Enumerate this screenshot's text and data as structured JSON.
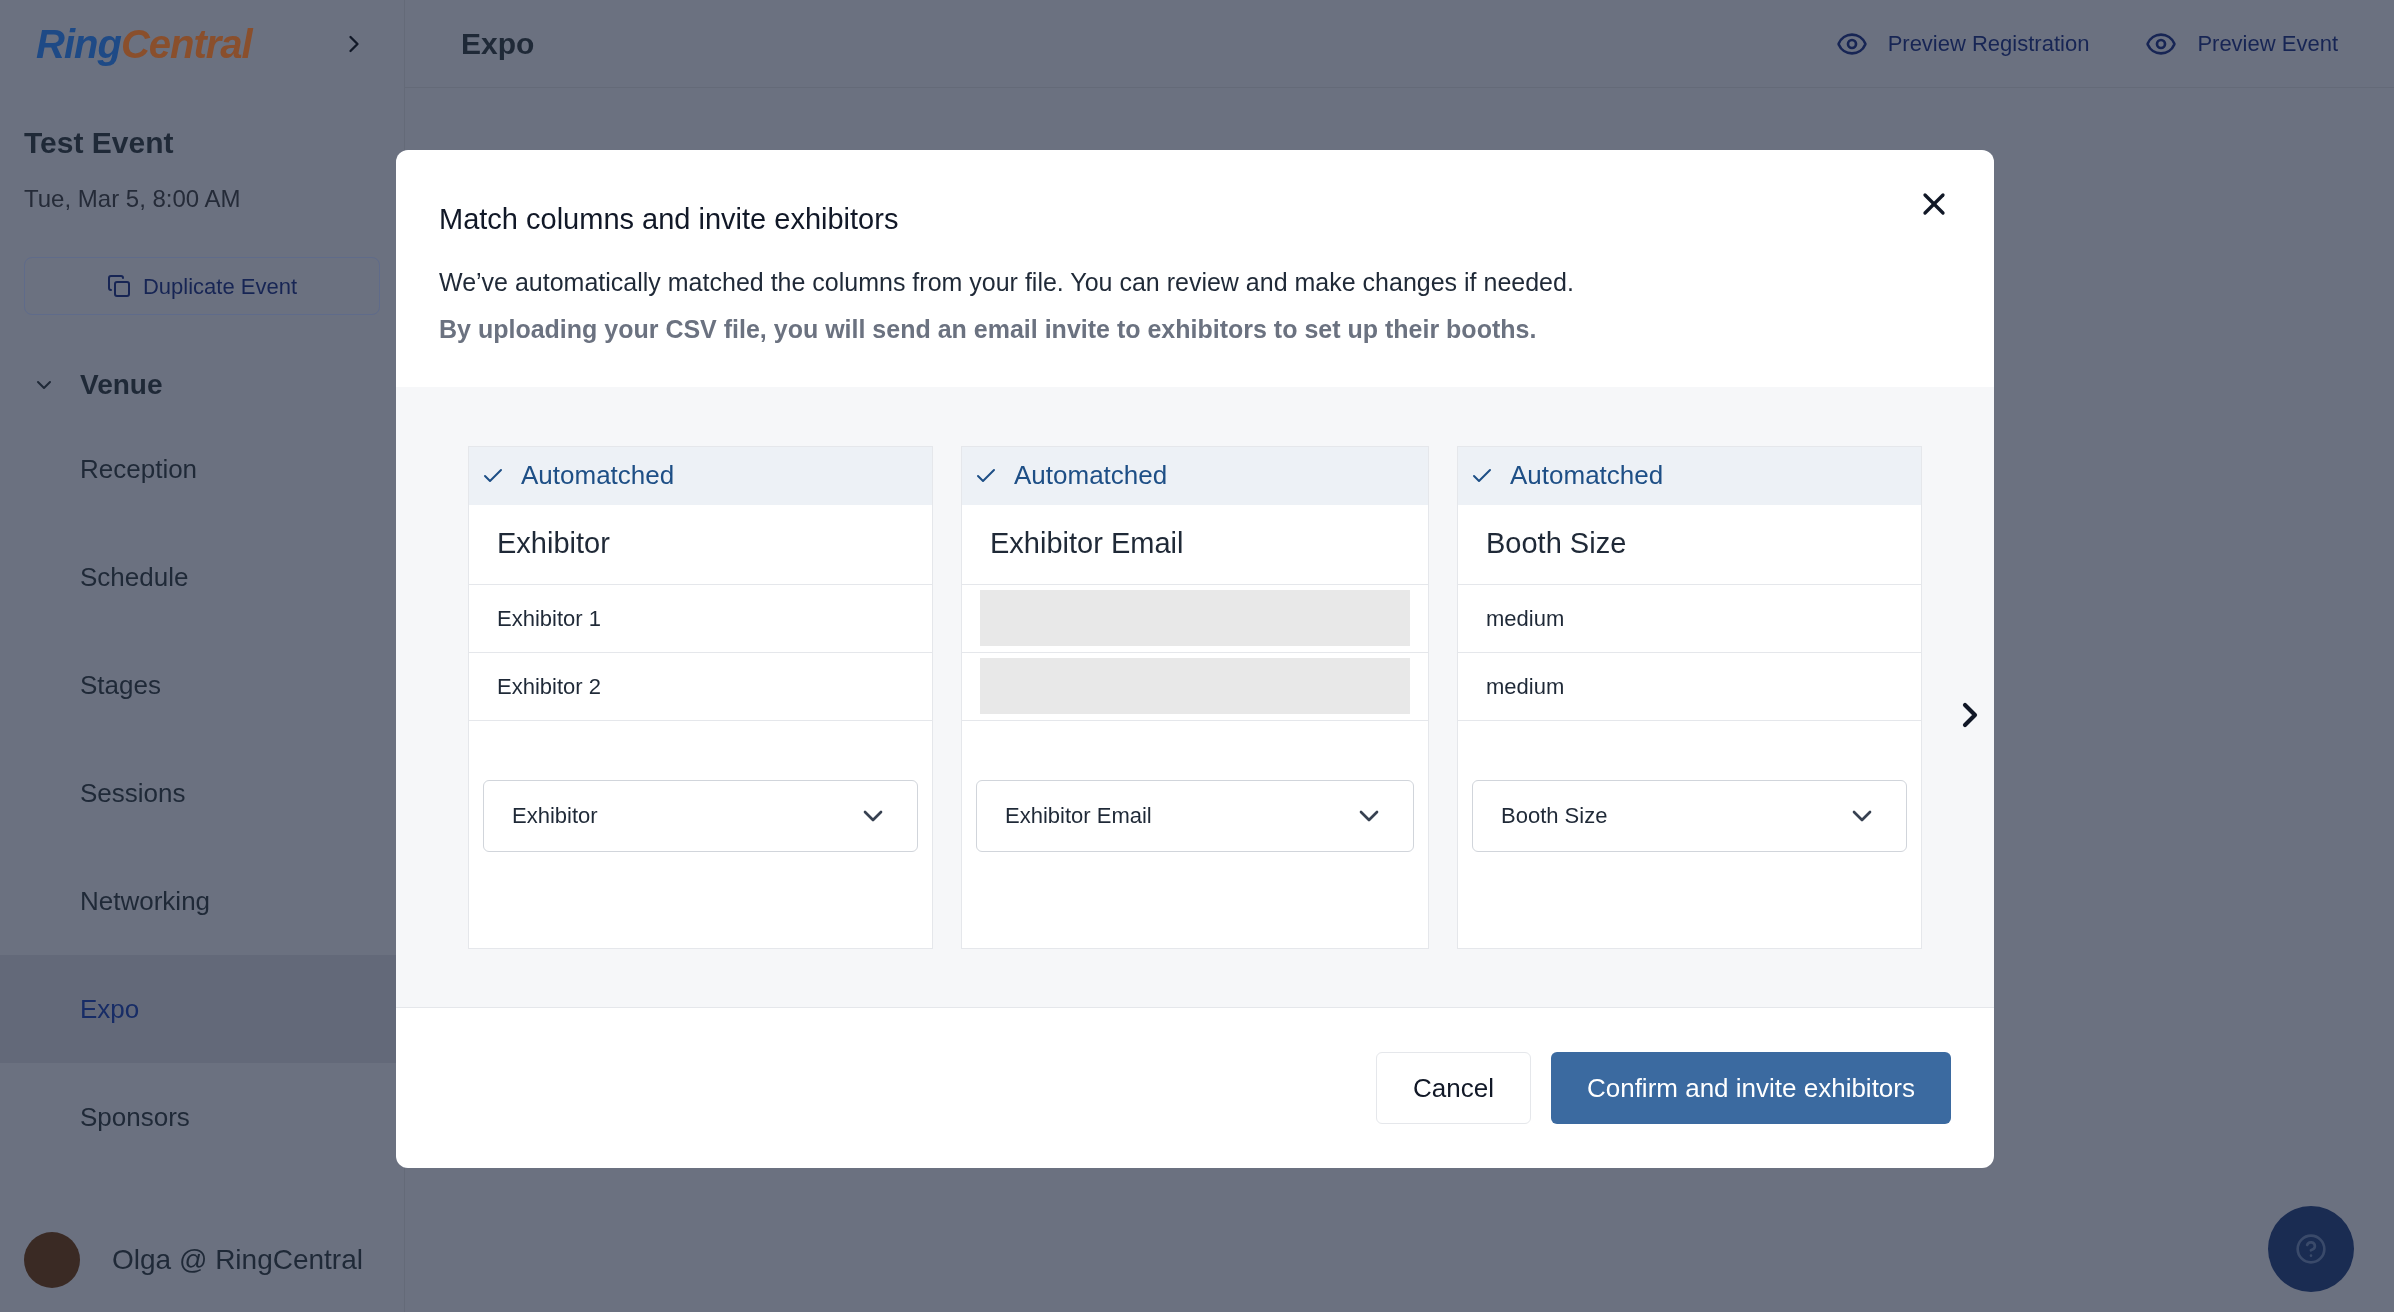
{
  "app": {
    "logo": {
      "part_1": "Ring",
      "part_2": "Central"
    },
    "page_title": "Expo",
    "header_actions": [
      "Preview Registration",
      "Preview Event"
    ],
    "event": {
      "name": "Test Event",
      "date": "Tue, Mar 5, 8:00 AM",
      "action": "Duplicate Event"
    },
    "nav": {
      "label": "Venue",
      "expanded": true,
      "children": [
        {
          "label": "Reception",
          "selected": false
        },
        {
          "label": "Schedule",
          "selected": false
        },
        {
          "label": "Stages",
          "selected": false
        },
        {
          "label": "Sessions",
          "selected": false
        },
        {
          "label": "Networking",
          "selected": false
        },
        {
          "label": "Expo",
          "selected": true
        },
        {
          "label": "Sponsors",
          "selected": false
        }
      ]
    },
    "user": {
      "name": "Olga @ RingCentral"
    }
  },
  "dialog": {
    "title": "Match columns and invite exhibitors",
    "description": "We’ve automatically matched the columns from your file. You can review and make changes if needed.",
    "note": "By uploading your CSV file, you will send an email invite to exhibitors to set up their booths.",
    "columns": [
      {
        "status": "Automatched",
        "matched": true,
        "heading": "Exhibitor",
        "cells": [
          {
            "kind": "text",
            "text": "Exhibitor 1"
          },
          {
            "kind": "text",
            "text": "Exhibitor 2"
          }
        ],
        "mapping": "Exhibitor"
      },
      {
        "status": "Automatched",
        "matched": true,
        "heading": "Exhibitor Email",
        "cells": [
          {
            "kind": "redacted"
          },
          {
            "kind": "redacted"
          }
        ],
        "mapping": "Exhibitor Email"
      },
      {
        "status": "Automatched",
        "matched": true,
        "heading": "Booth Size",
        "cells": [
          {
            "kind": "text",
            "text": "medium"
          },
          {
            "kind": "text",
            "text": "medium"
          }
        ],
        "mapping": "Booth Size"
      }
    ],
    "buttons": [
      {
        "label": "Cancel",
        "kind": "secondary"
      },
      {
        "label": "Confirm and invite exhibitors",
        "kind": "primary"
      }
    ]
  }
}
